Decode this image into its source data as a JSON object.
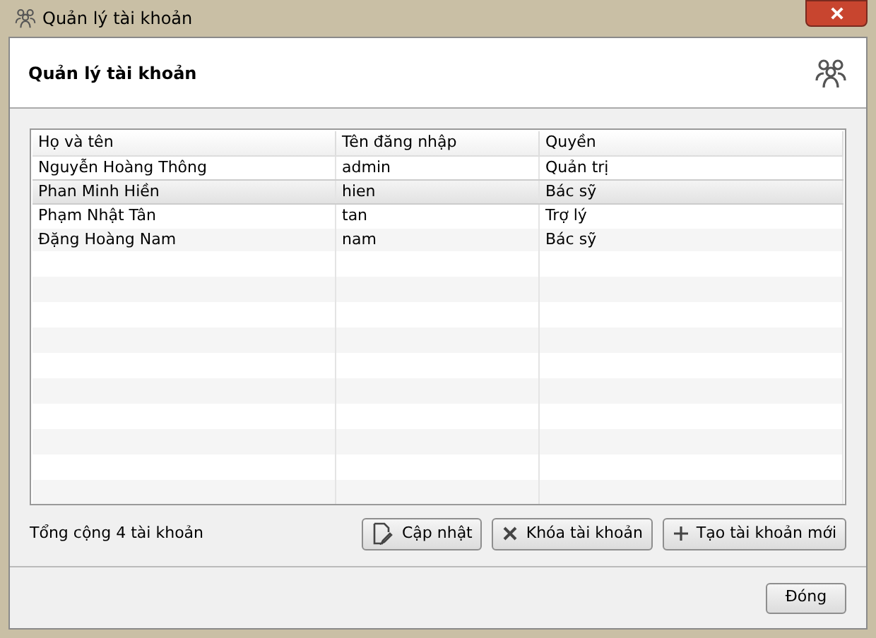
{
  "window": {
    "title": "Quản lý tài khoản"
  },
  "header": {
    "title": "Quản lý tài khoản"
  },
  "table": {
    "columns": [
      "Họ và tên",
      "Tên đăng nhập",
      "Quyền"
    ],
    "rows": [
      {
        "cells": [
          "Nguyễn Hoàng Thông",
          "admin",
          "Quản trị"
        ],
        "selected": false
      },
      {
        "cells": [
          "Phan Minh Hiền",
          "hien",
          "Bác sỹ"
        ],
        "selected": true
      },
      {
        "cells": [
          "Phạm Nhật Tân",
          "tan",
          "Trợ lý"
        ],
        "selected": false
      },
      {
        "cells": [
          "Đặng Hoàng Nam",
          "nam",
          "Bác sỹ"
        ],
        "selected": false
      }
    ]
  },
  "summary": "Tổng cộng 4 tài khoản",
  "actions": [
    {
      "kind": "edit",
      "label": "Cập nhật"
    },
    {
      "kind": "lock",
      "label": "Khóa tài khoản"
    },
    {
      "kind": "add",
      "label": "Tạo tài khoản mới"
    }
  ],
  "close_button": "Đóng"
}
